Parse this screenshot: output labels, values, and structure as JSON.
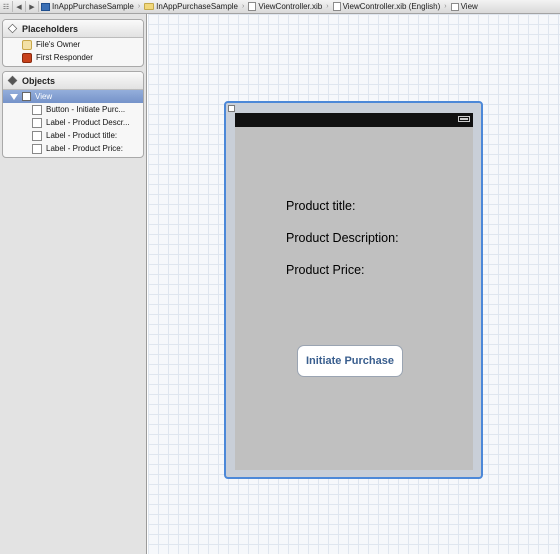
{
  "jumpbar": {
    "crumbs": [
      "InAppPurchaseSample",
      "InAppPurchaseSample",
      "ViewController.xib",
      "ViewController.xib (English)",
      "View"
    ]
  },
  "placeholders": {
    "title": "Placeholders",
    "items": [
      "File's Owner",
      "First Responder"
    ]
  },
  "objects": {
    "title": "Objects",
    "root": "View",
    "children": [
      "Button - Initiate Purc...",
      "Label - Product Descr...",
      "Label - Product title:",
      "Label - Product Price:"
    ]
  },
  "canvas": {
    "labels": {
      "title": "Product title:",
      "description": "Product Description:",
      "price": "Product Price:"
    },
    "button": "Initiate Purchase"
  }
}
